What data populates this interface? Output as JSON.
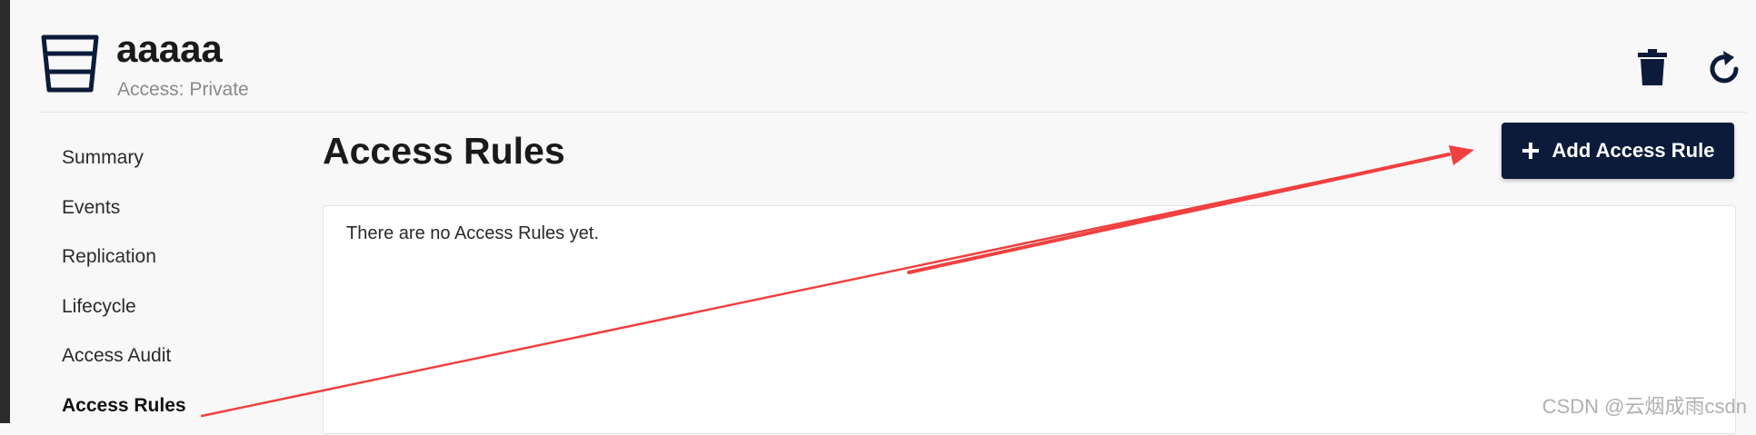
{
  "bucket": {
    "name": "aaaaa",
    "access": "Access: Private"
  },
  "header": {
    "delete_icon": "trash-icon",
    "refresh_icon": "refresh-icon"
  },
  "sidebar": {
    "items": [
      {
        "label": "Summary"
      },
      {
        "label": "Events"
      },
      {
        "label": "Replication"
      },
      {
        "label": "Lifecycle"
      },
      {
        "label": "Access Audit"
      },
      {
        "label": "Access Rules",
        "active": true
      }
    ]
  },
  "main": {
    "title": "Access Rules",
    "add_button_label": "Add Access Rule",
    "empty_message": "There are no Access Rules yet."
  },
  "annotation": {
    "color": "#f04040"
  },
  "watermark": "CSDN @云烟成雨csdn",
  "colors": {
    "primary": "#0d1b3a",
    "background": "#f8f8f8"
  }
}
